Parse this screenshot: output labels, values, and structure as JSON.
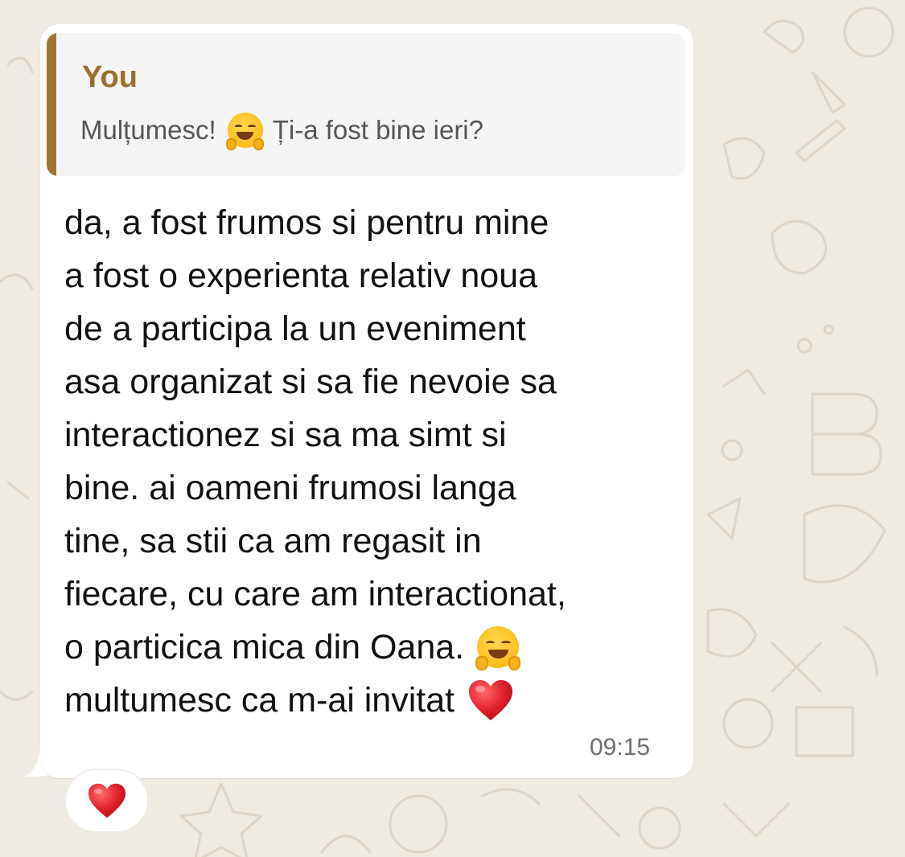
{
  "quoted_message": {
    "author": "You",
    "text_before_emoji": "Mulțumesc!",
    "emoji": "hugging-face-emoji",
    "text_after_emoji": "Ți-a fost bine ieri?"
  },
  "message": {
    "lines": [
      "da, a fost frumos si pentru mine",
      "a fost o experienta relativ noua",
      "de a participa la un eveniment",
      "asa organizat si sa fie nevoie sa",
      "interactionez si sa ma simt si",
      "bine. ai oameni frumosi langa",
      "tine, sa stii ca am regasit in",
      "fiecare, cu care am interactionat,",
      "o particica mica din Oana.",
      "multumesc ca m-ai invitat"
    ],
    "line9_emoji": "hugging-face-emoji",
    "line10_emoji": "red-heart-emoji",
    "time": "09:15"
  },
  "reaction": {
    "emoji": "red-heart-emoji"
  },
  "colors": {
    "wallpaper": "#efeae2",
    "bubble": "#ffffff",
    "quote_accent": "#a27434",
    "quote_author": "#9c6d2b"
  }
}
